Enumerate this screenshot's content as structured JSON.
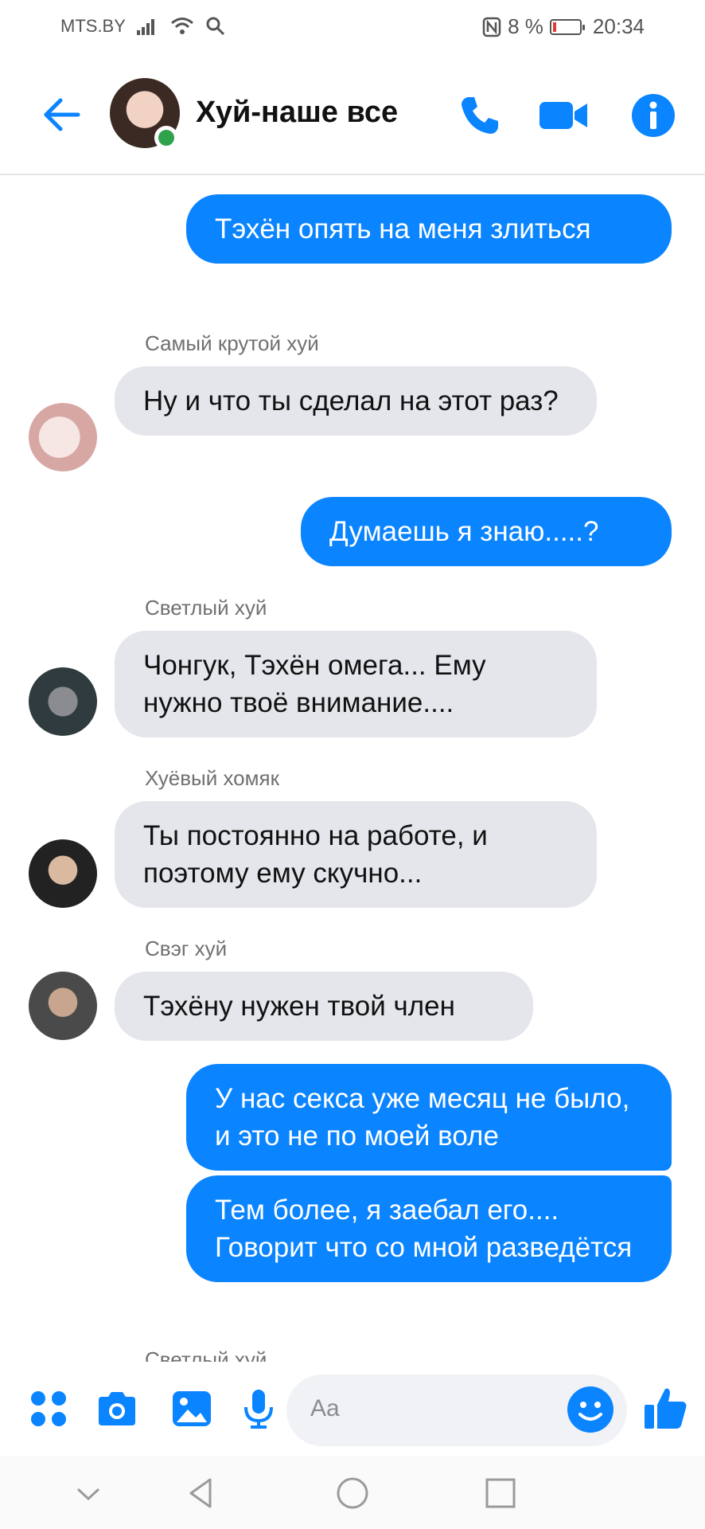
{
  "status_bar": {
    "carrier": "MTS.BY",
    "battery_percent": "8 %",
    "time": "20:34"
  },
  "header": {
    "title": "Хуй-наше все"
  },
  "messages": {
    "m1": "Тэхён опять на меня злиться",
    "m2": "Ну и что ты сделал на этот раз?",
    "m3": "Думаешь я знаю.....?",
    "m4": "Чонгук, Тэхён омега... Ему нужно твоё внимание....",
    "m5": "Ты постоянно на работе, и поэтому ему скучно...",
    "m6": "Тэхёну нужен твой член",
    "m7": "У нас секса уже месяц не было, и это не по моей воле",
    "m8": "Тем более, я заебал его.... Говорит что со мной разведётся"
  },
  "senders": {
    "s1": "Самый крутой хуй",
    "s2": "Светлый хуй",
    "s3": "Хуёвый хомяк",
    "s4": "Свэг хуй",
    "s5": "Светлый хуй"
  },
  "composer": {
    "placeholder": "Aa"
  },
  "colors": {
    "accent": "#0a84ff",
    "incoming_bubble": "#e4e6eb",
    "online": "#31a24c"
  },
  "icons": [
    "back-arrow-icon",
    "phone-icon",
    "video-camera-icon",
    "info-icon",
    "apps-grid-icon",
    "camera-icon",
    "gallery-icon",
    "microphone-icon",
    "emoji-icon",
    "like-thumb-icon",
    "nav-down-icon",
    "nav-back-icon",
    "nav-home-icon",
    "nav-recents-icon"
  ]
}
